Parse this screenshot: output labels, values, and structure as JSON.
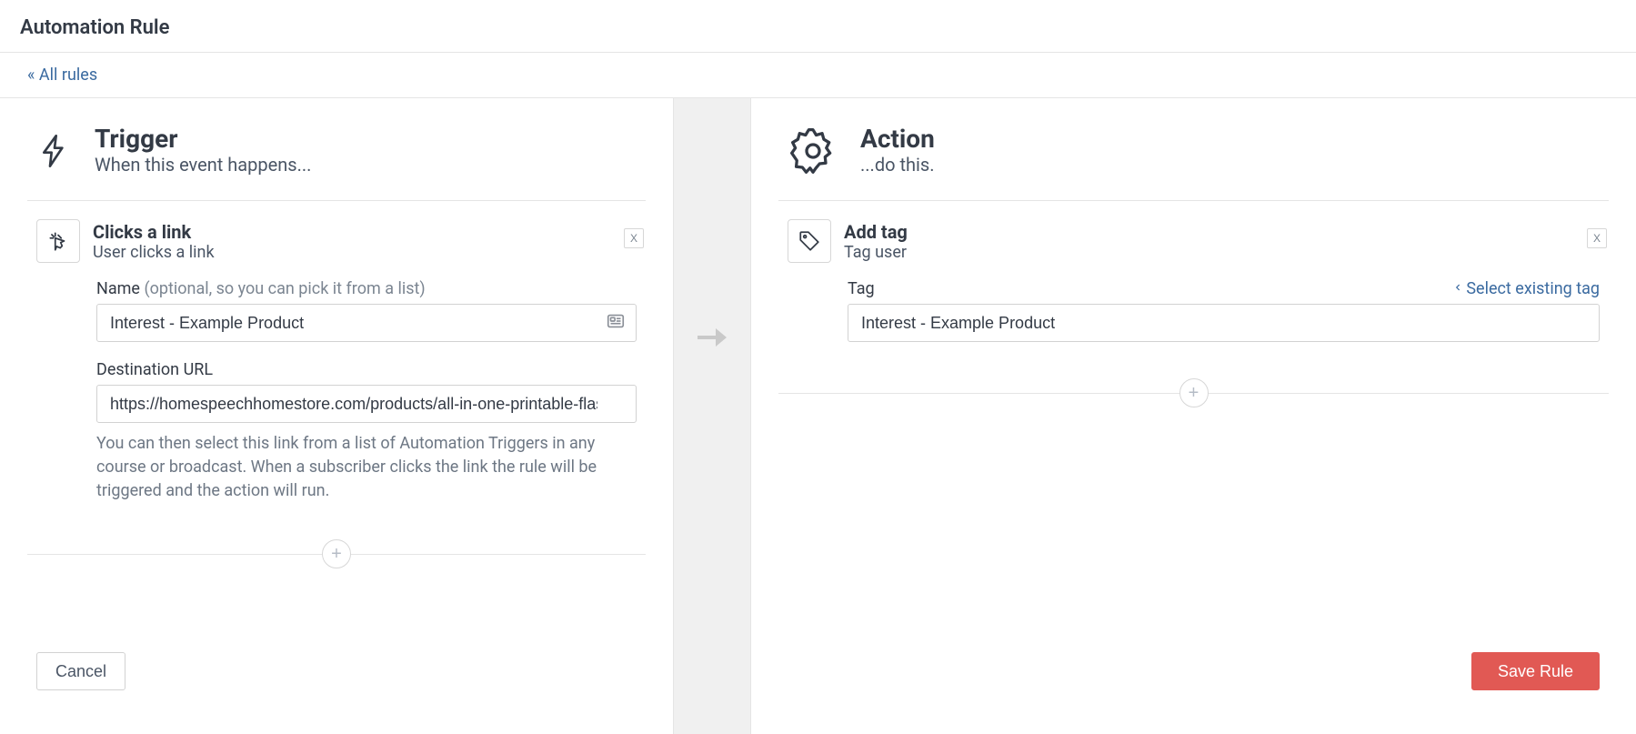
{
  "header": {
    "title": "Automation Rule"
  },
  "nav": {
    "back_link": "« All rules"
  },
  "trigger": {
    "title": "Trigger",
    "subtitle": "When this event happens...",
    "card": {
      "title": "Clicks a link",
      "subtitle": "User clicks a link",
      "remove": "X"
    },
    "name_label": "Name",
    "name_hint": "(optional, so you can pick it from a list)",
    "name_value": "Interest - Example Product",
    "url_label": "Destination URL",
    "url_value": "https://homespeechhomestore.com/products/all-in-one-printable-flashcards",
    "help": "You can then select this link from a list of Automation Triggers in any course or broadcast. When a subscriber clicks the link the rule will be triggered and the action will run.",
    "add": "+"
  },
  "action": {
    "title": "Action",
    "subtitle": "...do this.",
    "card": {
      "title": "Add tag",
      "subtitle": "Tag user",
      "remove": "X"
    },
    "tag_label": "Tag",
    "select_existing": "Select existing tag",
    "tag_value": "Interest - Example Product",
    "add": "+"
  },
  "footer": {
    "cancel": "Cancel",
    "save": "Save Rule"
  }
}
